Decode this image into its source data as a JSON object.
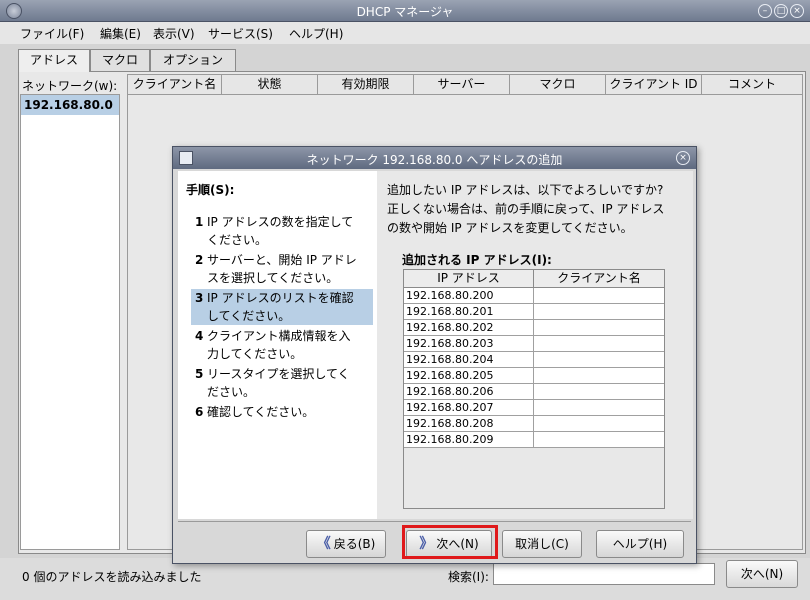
{
  "window": {
    "title": "DHCP マネージャ"
  },
  "menu": [
    "ファイル(F)",
    "編集(E)",
    "表示(V)",
    "サービス(S)",
    "ヘルプ(H)"
  ],
  "tabs": [
    "アドレス",
    "マクロ",
    "オプション"
  ],
  "network": {
    "label": "ネットワーク(w):",
    "items": [
      "192.168.80.0"
    ]
  },
  "grid": {
    "columns": [
      "クライアント名",
      "状態",
      "有効期限",
      "サーバー",
      "マクロ",
      "クライアント ID",
      "コメント"
    ]
  },
  "status": {
    "text": "0 個のアドレスを読み込みました",
    "search_label": "検索(I):",
    "next_label": "次へ(N)"
  },
  "dialog": {
    "title": "ネットワーク 192.168.80.0 へアドレスの追加",
    "steps_title": "手順(S):",
    "steps": [
      {
        "n": "1",
        "lines": [
          "IP アドレスの数を指定して",
          "ください。"
        ]
      },
      {
        "n": "2",
        "lines": [
          "サーバーと、開始 IP アドレ",
          "スを選択してください。"
        ]
      },
      {
        "n": "3",
        "lines": [
          "IP アドレスのリストを確認",
          "してください。"
        ]
      },
      {
        "n": "4",
        "lines": [
          "クライアント構成情報を入",
          "力してください。"
        ]
      },
      {
        "n": "5",
        "lines": [
          "リースタイプを選択してく",
          "ださい。"
        ]
      },
      {
        "n": "6",
        "lines": [
          "確認してください。"
        ]
      }
    ],
    "instruction_lines": [
      "追加したい IP アドレスは、以下でよろしいですか?",
      "正しくない場合は、前の手順に戻って、IP アドレス",
      "の数や開始 IP アドレスを変更してください。"
    ],
    "table_label": "追加される IP アドレス(I):",
    "table_columns": [
      "IP アドレス",
      "クライアント名"
    ],
    "ip_rows": [
      "192.168.80.200",
      "192.168.80.201",
      "192.168.80.202",
      "192.168.80.203",
      "192.168.80.204",
      "192.168.80.205",
      "192.168.80.206",
      "192.168.80.207",
      "192.168.80.208",
      "192.168.80.209"
    ],
    "buttons": {
      "back": "戻る(B)",
      "next": "次へ(N)",
      "cancel": "取消し(C)",
      "help": "ヘルプ(H)"
    }
  }
}
